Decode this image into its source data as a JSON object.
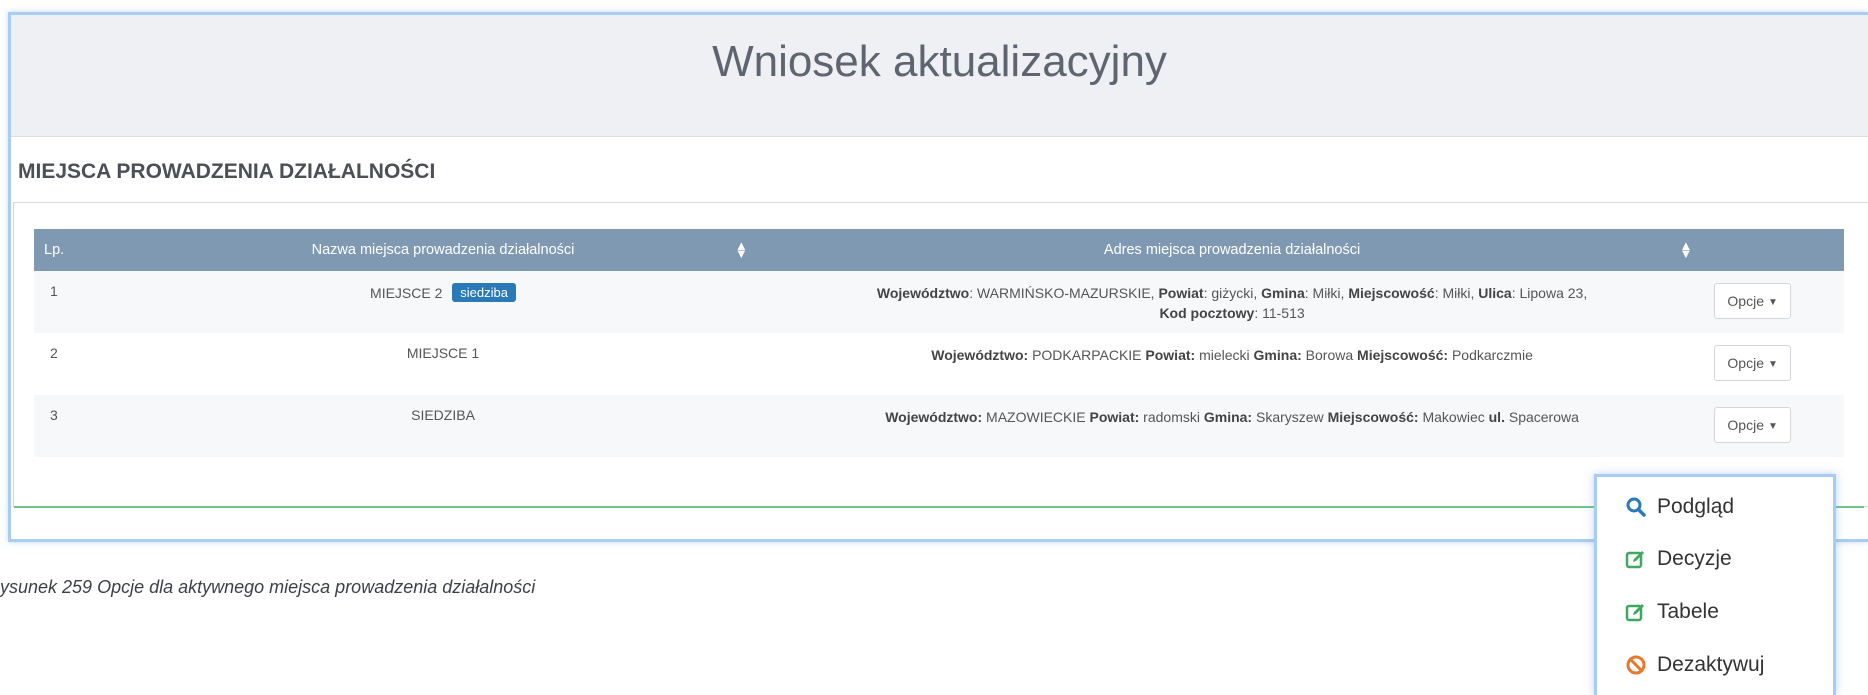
{
  "page": {
    "title": "Wniosek aktualizacyjny",
    "section_title": "MIEJSCA PROWADZENIA DZIAŁALNOŚCI",
    "caption": "ysunek 259 Opcje dla aktywnego miejsca prowadzenia działalności"
  },
  "table": {
    "headers": {
      "lp": "Lp.",
      "name": "Nazwa miejsca prowadzenia działalności",
      "address": "Adres miejsca prowadzenia działalności"
    },
    "rows": [
      {
        "lp": "1",
        "name": "MIEJSCE 2",
        "badge": "siedziba",
        "address": [
          {
            "label": "Województwo",
            "sep": ": ",
            "value": "WARMIŃSKO-MAZURSKIE, "
          },
          {
            "label": "Powiat",
            "sep": ": ",
            "value": "giżycki, "
          },
          {
            "label": "Gmina",
            "sep": ": ",
            "value": "Miłki, "
          },
          {
            "label": "Miejscowość",
            "sep": ": ",
            "value": "Miłki, "
          },
          {
            "label": "Ulica",
            "sep": ": ",
            "value": "Lipowa 23,"
          },
          {
            "label": "Kod pocztowy",
            "sep": ": ",
            "value": "11-513"
          }
        ],
        "options_label": "Opcje"
      },
      {
        "lp": "2",
        "name": "MIEJSCE 1",
        "address": [
          {
            "label": "Województwo:",
            "value": " PODKARPACKIE "
          },
          {
            "label": "Powiat:",
            "value": " mielecki "
          },
          {
            "label": "Gmina:",
            "value": " Borowa "
          },
          {
            "label": "Miejscowość:",
            "value": " Podkarczmie"
          }
        ],
        "options_label": "Opcje"
      },
      {
        "lp": "3",
        "name": "SIEDZIBA",
        "address": [
          {
            "label": "Województwo:",
            "value": " MAZOWIECKIE "
          },
          {
            "label": "Powiat:",
            "value": " radomski "
          },
          {
            "label": "Gmina:",
            "value": " Skaryszew "
          },
          {
            "label": "Miejscowość:",
            "value": " Makowiec "
          },
          {
            "label": "ul.",
            "value": " Spacerowa"
          }
        ],
        "options_label": "Opcje"
      }
    ]
  },
  "dropdown": {
    "items": [
      {
        "label": "Podgląd",
        "icon": "search-icon"
      },
      {
        "label": "Decyzje",
        "icon": "edit-icon"
      },
      {
        "label": "Tabele",
        "icon": "edit-icon"
      },
      {
        "label": "Dezaktywuj",
        "icon": "ban-icon"
      }
    ]
  },
  "colors": {
    "header_bg": "#8099b3",
    "badge": "#2a7ab8",
    "frame_border": "#a9cdf0",
    "accent_green": "#3fa85f",
    "ban_orange": "#e8782e"
  }
}
